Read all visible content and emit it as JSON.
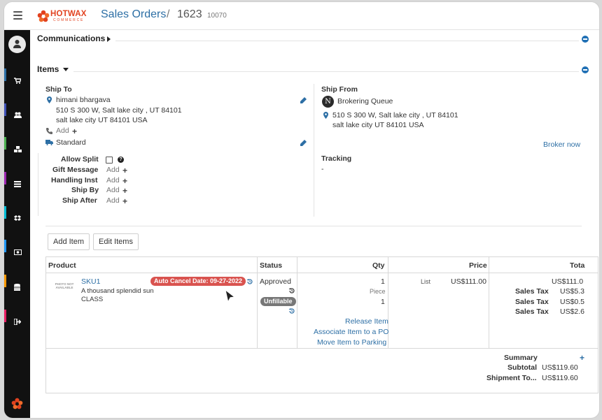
{
  "app": {
    "logo": {
      "name": "HOTWAX",
      "sub": "COMMERCE"
    },
    "breadcrumb": {
      "section": "Sales Orders",
      "separator": "/",
      "order_id": "1623",
      "external_id": "10070"
    }
  },
  "sections": {
    "communications": "Communications",
    "items": "Items"
  },
  "ship_to": {
    "label": "Ship To",
    "name": "himani bhargava",
    "address_line1": "510 S 300 W, Salt lake city , UT 84101",
    "address_line2": "salt lake city UT 84101 USA",
    "phone_add": "Add",
    "shipping_method": "Standard",
    "options": [
      {
        "label": "Allow Split",
        "value": ""
      },
      {
        "label": "Gift Message",
        "value": "Add"
      },
      {
        "label": "Handling Inst",
        "value": "Add"
      },
      {
        "label": "Ship By",
        "value": "Add"
      },
      {
        "label": "Ship After",
        "value": "Add"
      }
    ]
  },
  "ship_from": {
    "label": "Ship From",
    "facility_initial": "N",
    "facility": "Brokering Queue",
    "address_line1": "510 S 300 W, Salt lake city , UT 84101",
    "address_line2": "salt lake city UT 84101 USA",
    "broker_link": "Broker now",
    "tracking_label": "Tracking",
    "tracking_value": "-"
  },
  "actions": {
    "add_item": "Add Item",
    "edit_items": "Edit Items"
  },
  "table": {
    "headers": {
      "product": "Product",
      "status": "Status",
      "qty": "Qty",
      "price": "Price",
      "total": "Tota"
    },
    "row": {
      "thumb_text": "PHOTO NOT AVAILABLE",
      "sku": "SKU1",
      "cancel_badge": "Auto Cancel Date: 09-27-2022",
      "description": "A thousand splendid sun",
      "class": "CLASS",
      "status": "Approved",
      "status_badge": "Unfillable",
      "qty": "1",
      "qty_unit": "Piece",
      "qty_second": "1",
      "price_type": "List",
      "price": "US$111.00",
      "total": "US$111.0",
      "taxes": [
        {
          "label": "Sales Tax",
          "value": "US$5.3"
        },
        {
          "label": "Sales Tax",
          "value": "US$0.5"
        },
        {
          "label": "Sales Tax",
          "value": "US$2.6"
        }
      ],
      "item_actions": [
        "Release Item",
        "Associate Item to a PO",
        "Move Item to Parking"
      ]
    },
    "summary": {
      "label": "Summary",
      "subtotal_label": "Subtotal",
      "subtotal_value": "US$119.60",
      "shipment_label": "Shipment To...",
      "shipment_value": "US$119.60"
    }
  },
  "colors": {
    "accent": "#2d6fa5",
    "danger": "#d9534f",
    "sidebar": "#111111",
    "brand": "#e2421f"
  }
}
